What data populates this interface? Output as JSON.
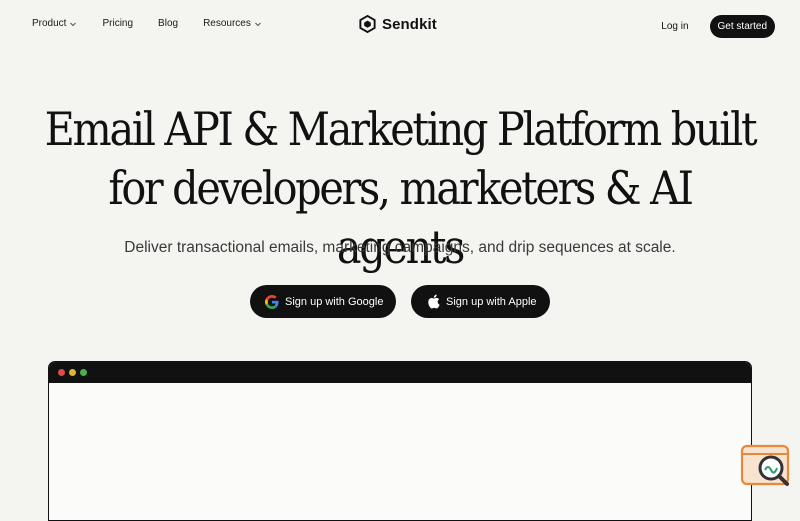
{
  "nav": {
    "product": "Product",
    "pricing": "Pricing",
    "blog": "Blog",
    "resources": "Resources",
    "brand": "Sendkit",
    "login": "Log in",
    "get_started": "Get started"
  },
  "hero": {
    "title_line1": "Email API & Marketing Platform built",
    "title_line2": "for developers, marketers & AI agents",
    "subtitle": "Deliver transactional emails, marketing campaigns, and drip sequences at scale."
  },
  "cta": {
    "google": "Sign up with Google",
    "apple": "Sign up with Apple"
  },
  "icons": {
    "logo": "sendkit-logo-icon",
    "google": "google-icon",
    "apple": "apple-icon",
    "chevron": "chevron-down-icon",
    "badge": "search-widget-icon"
  },
  "colors": {
    "background": "#f4f4f1",
    "primary": "#111111",
    "window_red": "#e24a45",
    "window_yellow": "#dcb53b",
    "window_green": "#46b348",
    "badge_accent": "#e8893a"
  }
}
